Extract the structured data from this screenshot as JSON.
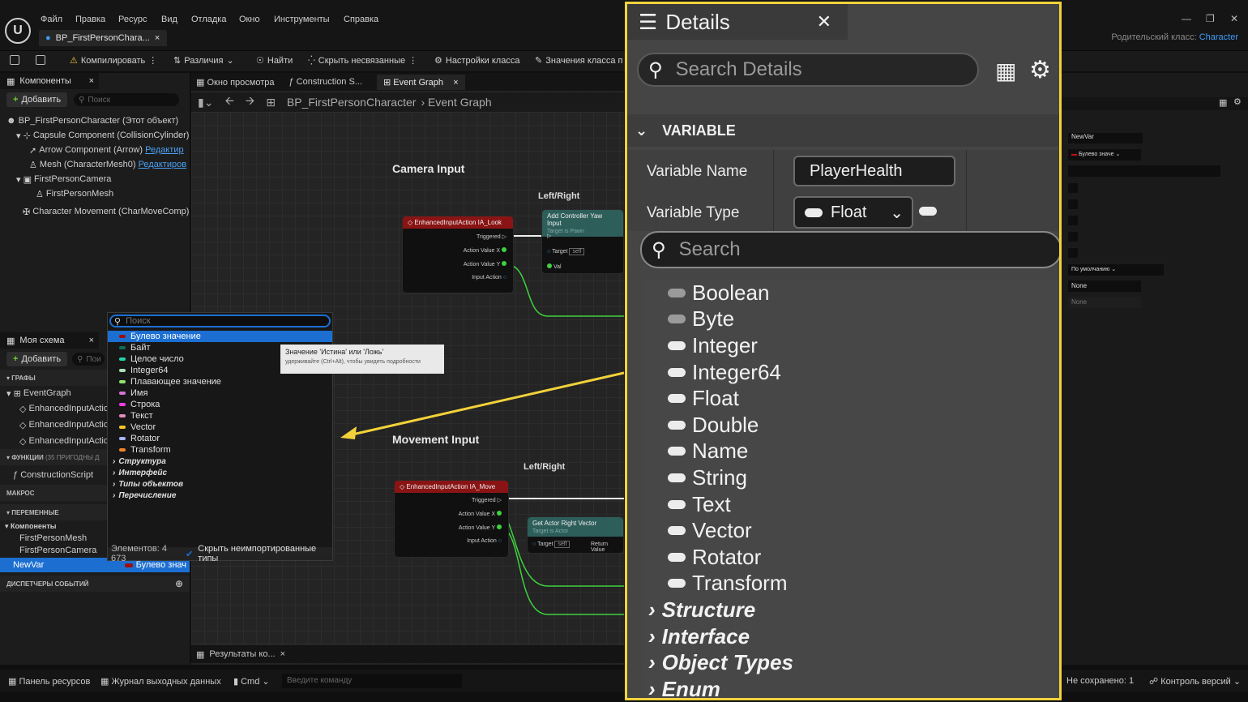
{
  "menu": [
    "Файл",
    "Правка",
    "Ресурс",
    "Вид",
    "Отладка",
    "Окно",
    "Инструменты",
    "Справка"
  ],
  "doc_tab": "BP_FirstPersonChara...",
  "parent_class_label": "Родительский класс:",
  "parent_class_value": "Character",
  "toolbar": {
    "compile": "Компилировать",
    "diff": "Различия",
    "find": "Найти",
    "hide_unrelated": "Скрыть несвязанные",
    "class_settings": "Настройки класса",
    "class_defaults": "Значения класса п"
  },
  "components": {
    "title": "Компоненты",
    "add": "Добавить",
    "search": "Поиск",
    "items": [
      "BP_FirstPersonCharacter (Этот объект)",
      "Capsule Component (CollisionCylinder)",
      "Arrow Component (Arrow)",
      "Mesh (CharacterMesh0)",
      "FirstPersonCamera",
      "FirstPersonMesh",
      "Character Movement (CharMoveComp)"
    ],
    "edit1": "Редактир",
    "edit2": "Редактиров"
  },
  "graph_tabs": [
    "Окно просмотра",
    "Construction S...",
    "Event Graph"
  ],
  "breadcrumb": {
    "root": "BP_FirstPersonCharacter",
    "leaf": "Event Graph"
  },
  "graph": {
    "camera_input": "Camera Input",
    "movement_input": "Movement Input",
    "left_right_1": "Left/Right",
    "left_right_2": "Left/Right",
    "node_look": "EnhancedInputAction IA_Look",
    "node_move": "EnhancedInputAction IA_Move",
    "node_yaw": "Add Controller Yaw Input",
    "node_yaw_sub": "Target is Pawn",
    "node_rightvec": "Get Actor Right Vector",
    "node_rightvec_sub": "Target is Actor",
    "pins": {
      "triggered": "Triggered",
      "ax": "Action Value X",
      "ay": "Action Value Y",
      "ia": "Input Action",
      "target": "Target",
      "self": "self",
      "val": "Val",
      "retval": "Return Value"
    }
  },
  "myschema": {
    "title": "Моя схема",
    "add": "Добавить",
    "search": "Пои",
    "graphs": "ГРАФЫ",
    "eventgraph": "EventGraph",
    "events": [
      "EnhancedInputActio",
      "EnhancedInputActio",
      "EnhancedInputActio"
    ],
    "functions": "ФУНКЦИИ",
    "functions_count": "(35 ПРИГОДНЫ Д",
    "construction": "ConstructionScript",
    "macros": "МАКРОС",
    "variables": "ПЕРЕМЕННЫЕ",
    "components": "Компоненты",
    "vars": [
      "FirstPersonMesh",
      "FirstPersonCamera"
    ],
    "newvar": "NewVar",
    "newvar_type": "Булево знач",
    "dispatchers": "ДИСПЕТЧЕРЫ СОБЫТИЙ"
  },
  "type_menu": {
    "search": "Поиск",
    "items": [
      {
        "label": "Булево значение",
        "color": "#9c0f0f"
      },
      {
        "label": "Байт",
        "color": "#0a6e5a"
      },
      {
        "label": "Целое число",
        "color": "#22d4a8"
      },
      {
        "label": "Integer64",
        "color": "#a8e0b8"
      },
      {
        "label": "Плавающее значение",
        "color": "#8ee36f"
      },
      {
        "label": "Имя",
        "color": "#d672d6"
      },
      {
        "label": "Строка",
        "color": "#f23ce4"
      },
      {
        "label": "Текст",
        "color": "#e38bbd"
      },
      {
        "label": "Vector",
        "color": "#f5c42a"
      },
      {
        "label": "Rotator",
        "color": "#a3b6f5"
      },
      {
        "label": "Transform",
        "color": "#f0862a"
      }
    ],
    "cats": [
      "Структура",
      "Интерфейс",
      "Типы объектов",
      "Перечисление"
    ],
    "count": "Элементов: 4 673",
    "hide": "Скрыть неимпортированные типы"
  },
  "tooltip": {
    "title": "Значение 'Истина' или 'Ложь'",
    "hint": "удерживайте (Ctrl+Alt), чтобы увидеть подробности"
  },
  "right_panel": {
    "newvar": "NewVar",
    "type": "Булево значе",
    "default": "По умолчанию",
    "none1": "None",
    "none2": "None"
  },
  "results_tab": "Результаты ко...",
  "status": {
    "content": "Панель ресурсов",
    "log": "Журнал выходных данных",
    "cmd": "Cmd",
    "cmd_placeholder": "Введите команду",
    "unsaved": "Не сохранено: 1",
    "vcs": "Контроль версий"
  },
  "zoom": {
    "title": "Details",
    "search": "Search Details",
    "section": "VARIABLE",
    "var_name_label": "Variable Name",
    "var_name": "PlayerHealth",
    "var_type_label": "Variable Type",
    "var_type": "Float",
    "dd_search": "Search",
    "types": [
      "Boolean",
      "Byte",
      "Integer",
      "Integer64",
      "Float",
      "Double",
      "Name",
      "String",
      "Text",
      "Vector",
      "Rotator",
      "Transform"
    ],
    "cats": [
      "Structure",
      "Interface",
      "Object Types",
      "Enum"
    ]
  },
  "colors": {
    "highlight": "#f2d23a",
    "accent": "#3d9cf5",
    "selected": "#1c6fd1"
  }
}
